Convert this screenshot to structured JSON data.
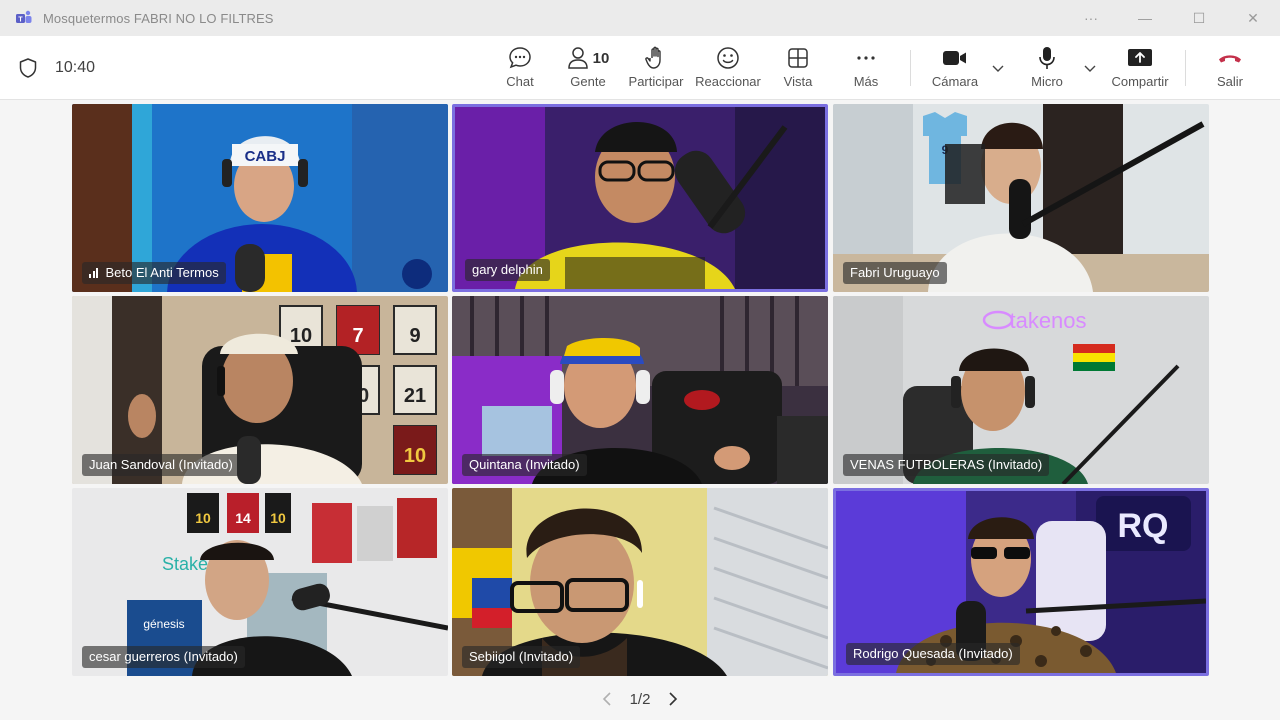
{
  "window": {
    "title": "Mosquetermos FABRI NO LO FILTRES",
    "controls": [
      "···",
      "—",
      "☐",
      "✕"
    ]
  },
  "toolbar": {
    "time": "10:40",
    "chat_label": "Chat",
    "people_label": "Gente",
    "people_count": "10",
    "raise_label": "Participar",
    "react_label": "Reaccionar",
    "view_label": "Vista",
    "more_label": "Más",
    "camera_label": "Cámara",
    "mic_label": "Micro",
    "share_label": "Compartir",
    "leave_label": "Salir",
    "leave_color": "#c4314b"
  },
  "participants": [
    {
      "name": "Beto El Anti Termos",
      "speaking_indicator": true,
      "active": false
    },
    {
      "name": "gary delphin",
      "active": true
    },
    {
      "name": "Fabri Uruguayo",
      "active": false
    },
    {
      "name": "Juan Sandoval (Invitado)",
      "active": false
    },
    {
      "name": "Quintana (Invitado)",
      "active": false
    },
    {
      "name": "VENAS FUTBOLERAS (Invitado)",
      "active": false
    },
    {
      "name": "cesar guerreros (Invitado)",
      "active": false
    },
    {
      "name": "Sebiigol (Invitado)",
      "active": false
    },
    {
      "name": "Rodrigo Quesada (Invitado)",
      "active": true
    }
  ],
  "pagination": {
    "text": "1/2"
  },
  "accent_color": "#7b6fe0",
  "scene_text": {
    "takenos": "takenos",
    "cap": "CABJ",
    "jersey_9": "9",
    "rq": "RQ",
    "stake": "Stake",
    "genesis": "génesis",
    "j10": "10",
    "j7": "7",
    "j9": "9",
    "j10b": "10",
    "j21": "21",
    "j10c": "10",
    "j14": "14"
  }
}
